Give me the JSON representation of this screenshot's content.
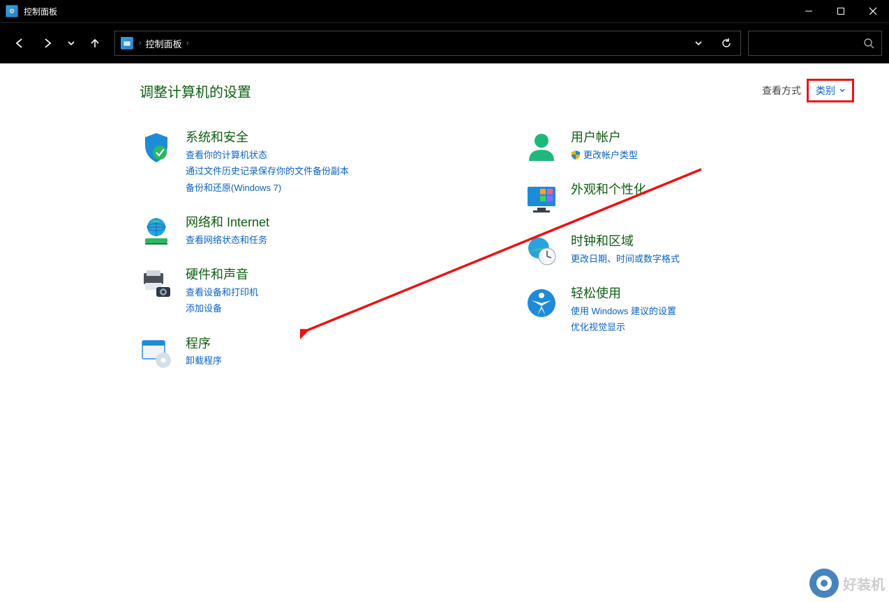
{
  "window": {
    "title": "控制面板"
  },
  "breadcrumb": {
    "location": "控制面板",
    "sep": "›"
  },
  "page": {
    "heading": "调整计算机的设置",
    "view_label": "查看方式",
    "view_value": "类别"
  },
  "left_items": [
    {
      "title": "系统和安全",
      "links": [
        "查看你的计算机状态",
        "通过文件历史记录保存你的文件备份副本",
        "备份和还原(Windows 7)"
      ]
    },
    {
      "title": "网络和 Internet",
      "links": [
        "查看网络状态和任务"
      ]
    },
    {
      "title": "硬件和声音",
      "links": [
        "查看设备和打印机",
        "添加设备"
      ]
    },
    {
      "title": "程序",
      "links": [
        "卸载程序"
      ]
    }
  ],
  "right_items": [
    {
      "title": "用户帐户",
      "links": [
        "更改帐户类型"
      ],
      "shielded": [
        0
      ]
    },
    {
      "title": "外观和个性化",
      "links": []
    },
    {
      "title": "时钟和区域",
      "links": [
        "更改日期、时间或数字格式"
      ]
    },
    {
      "title": "轻松使用",
      "links": [
        "使用 Windows 建议的设置",
        "优化视觉显示"
      ]
    }
  ],
  "watermark": "好装机"
}
